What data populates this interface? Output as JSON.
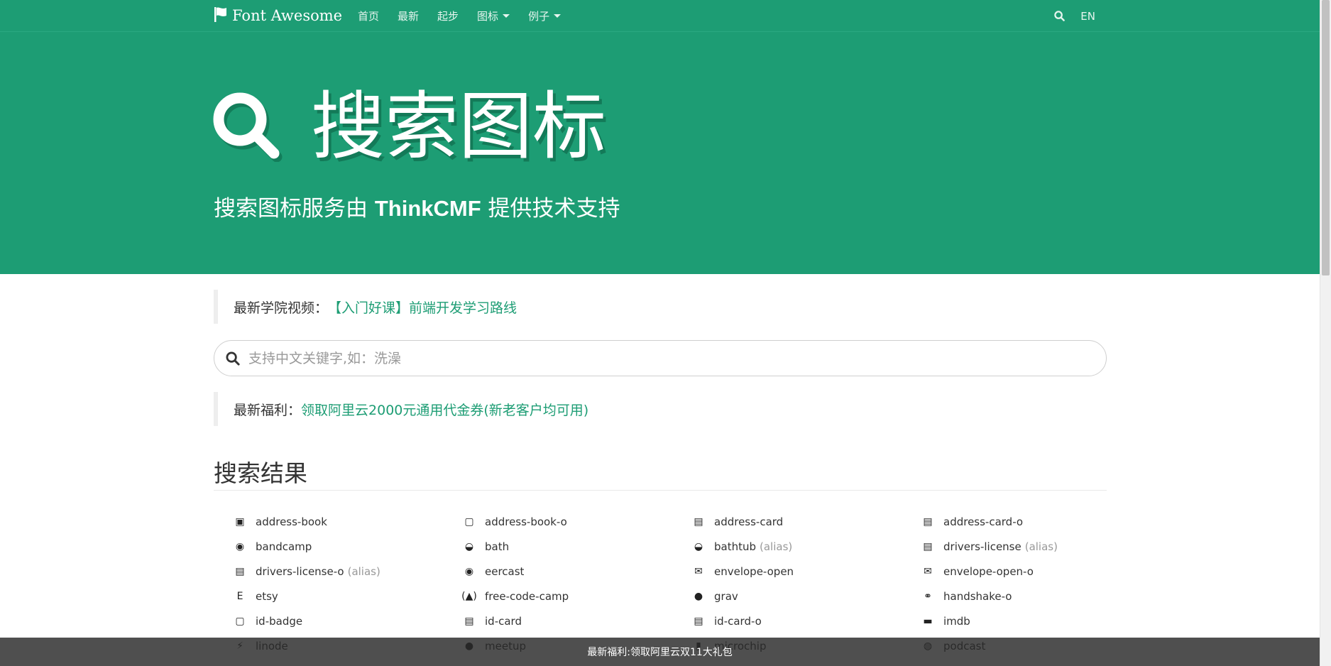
{
  "nav": {
    "brand": "Font Awesome",
    "links": [
      {
        "label": "首页",
        "dropdown": false
      },
      {
        "label": "最新",
        "dropdown": false
      },
      {
        "label": "起步",
        "dropdown": false
      },
      {
        "label": "图标",
        "dropdown": true
      },
      {
        "label": "例子",
        "dropdown": true
      }
    ],
    "lang": "EN"
  },
  "hero": {
    "title": "搜索图标",
    "subtitle_pre": "搜索图标服务由 ",
    "subtitle_brand": "ThinkCMF",
    "subtitle_post": " 提供技术支持"
  },
  "notice1": {
    "label": "最新学院视频：",
    "link": "【入门好课】前端开发学习路线"
  },
  "search": {
    "placeholder": "支持中文关键字,如：洗澡",
    "value": ""
  },
  "notice2": {
    "label": "最新福利：",
    "link": "领取阿里云2000元通用代金券(新老客户均可用)"
  },
  "results": {
    "title": "搜索结果",
    "alias_label": "(alias)",
    "items": [
      {
        "name": "address-book",
        "icon": "address-book-icon",
        "glyph": "▣",
        "alias": false
      },
      {
        "name": "address-book-o",
        "icon": "address-book-o-icon",
        "glyph": "▢",
        "alias": false
      },
      {
        "name": "address-card",
        "icon": "address-card-icon",
        "glyph": "▤",
        "alias": false
      },
      {
        "name": "address-card-o",
        "icon": "address-card-o-icon",
        "glyph": "▤",
        "alias": false
      },
      {
        "name": "bandcamp",
        "icon": "bandcamp-icon",
        "glyph": "◉",
        "alias": false
      },
      {
        "name": "bath",
        "icon": "bath-icon",
        "glyph": "◒",
        "alias": false
      },
      {
        "name": "bathtub",
        "icon": "bathtub-icon",
        "glyph": "◒",
        "alias": true
      },
      {
        "name": "drivers-license",
        "icon": "drivers-license-icon",
        "glyph": "▤",
        "alias": true
      },
      {
        "name": "drivers-license-o",
        "icon": "drivers-license-o-icon",
        "glyph": "▤",
        "alias": true
      },
      {
        "name": "eercast",
        "icon": "eercast-icon",
        "glyph": "◉",
        "alias": false
      },
      {
        "name": "envelope-open",
        "icon": "envelope-open-icon",
        "glyph": "✉",
        "alias": false
      },
      {
        "name": "envelope-open-o",
        "icon": "envelope-open-o-icon",
        "glyph": "✉",
        "alias": false
      },
      {
        "name": "etsy",
        "icon": "etsy-icon",
        "glyph": "E",
        "alias": false
      },
      {
        "name": "free-code-camp",
        "icon": "free-code-camp-icon",
        "glyph": "(▲)",
        "alias": false
      },
      {
        "name": "grav",
        "icon": "grav-icon",
        "glyph": "●",
        "alias": false
      },
      {
        "name": "handshake-o",
        "icon": "handshake-o-icon",
        "glyph": "⚭",
        "alias": false
      },
      {
        "name": "id-badge",
        "icon": "id-badge-icon",
        "glyph": "▢",
        "alias": false
      },
      {
        "name": "id-card",
        "icon": "id-card-icon",
        "glyph": "▤",
        "alias": false
      },
      {
        "name": "id-card-o",
        "icon": "id-card-o-icon",
        "glyph": "▤",
        "alias": false
      },
      {
        "name": "imdb",
        "icon": "imdb-icon",
        "glyph": "▬",
        "alias": false
      },
      {
        "name": "linode",
        "icon": "linode-icon",
        "glyph": "⚡",
        "alias": false
      },
      {
        "name": "meetup",
        "icon": "meetup-icon",
        "glyph": "●",
        "alias": false
      },
      {
        "name": "microchip",
        "icon": "microchip-icon",
        "glyph": "▮",
        "alias": false
      },
      {
        "name": "podcast",
        "icon": "podcast-icon",
        "glyph": "◍",
        "alias": false
      }
    ]
  },
  "bottom_bar": {
    "text": "最新福利:领取阿里云双11大礼包"
  }
}
